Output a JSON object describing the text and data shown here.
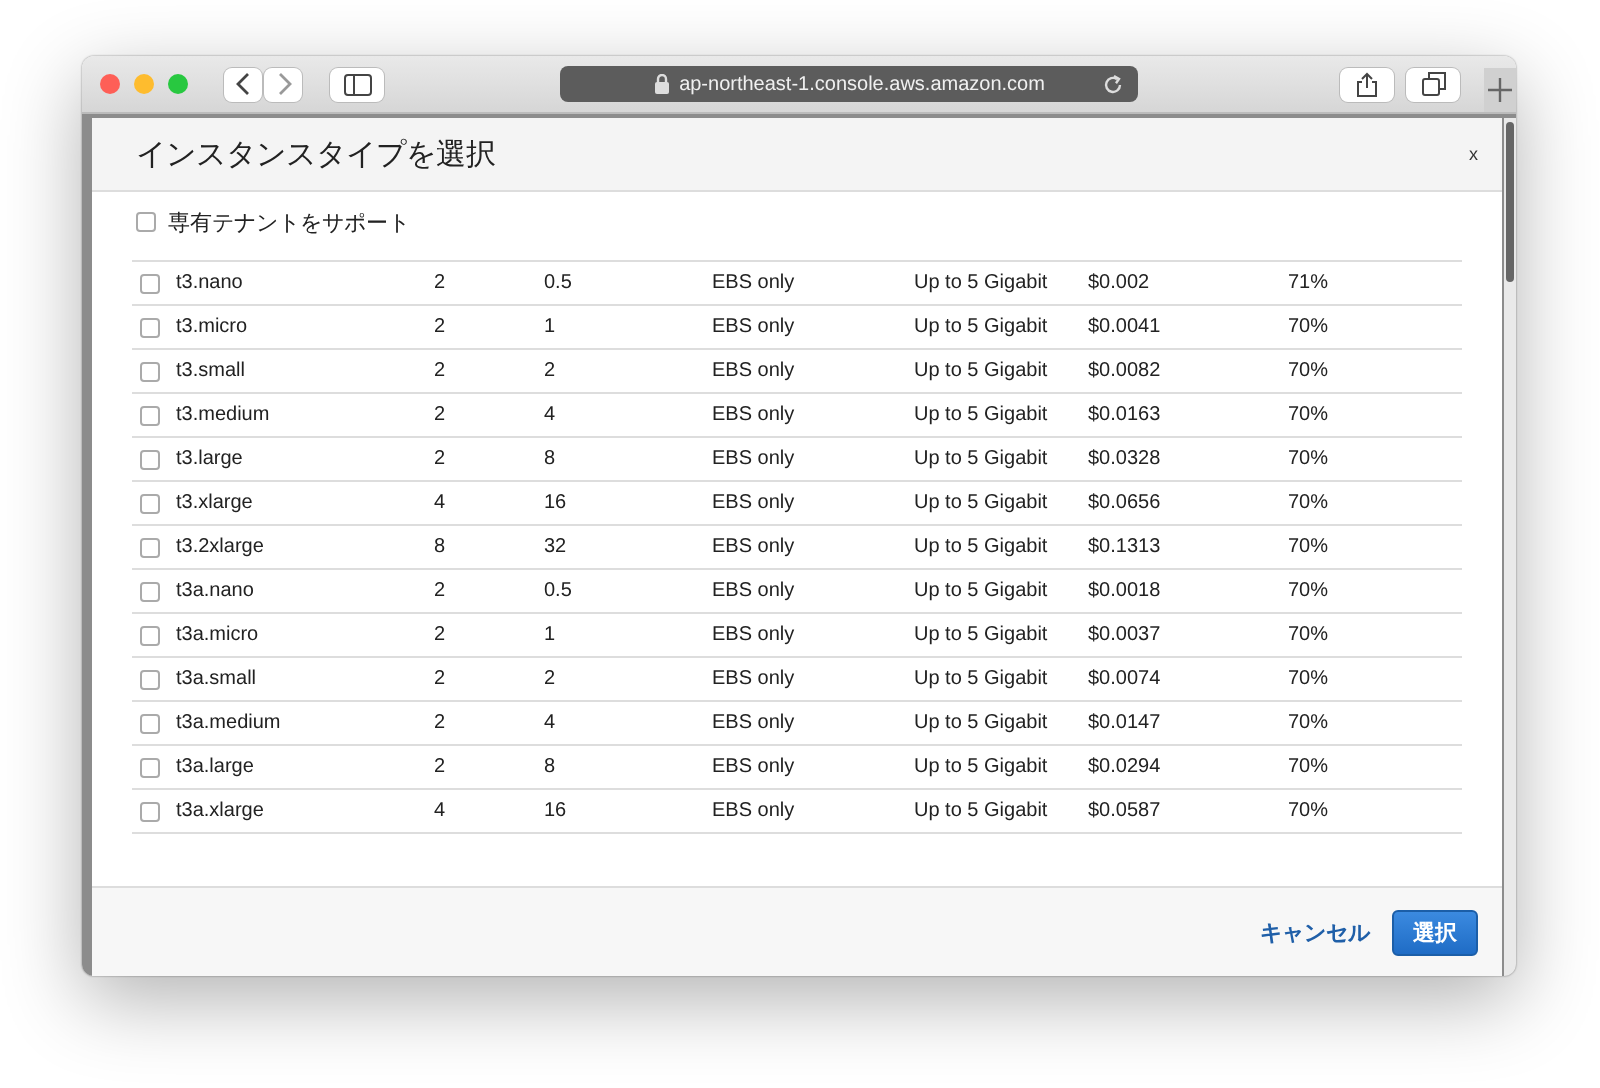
{
  "browser": {
    "url": "ap-northeast-1.console.aws.amazon.com"
  },
  "dialog": {
    "title": "インスタンスタイプを選択",
    "close": "x"
  },
  "filter": {
    "label": "専有テナントをサポート",
    "checked": false
  },
  "table": {
    "rows": [
      {
        "checked": false,
        "cells": [
          "t3.nano",
          "2",
          "0.5",
          "EBS only",
          "Up to 5 Gigabit",
          "$0.002",
          "71%"
        ]
      },
      {
        "checked": false,
        "cells": [
          "t3.micro",
          "2",
          "1",
          "EBS only",
          "Up to 5 Gigabit",
          "$0.0041",
          "70%"
        ]
      },
      {
        "checked": false,
        "cells": [
          "t3.small",
          "2",
          "2",
          "EBS only",
          "Up to 5 Gigabit",
          "$0.0082",
          "70%"
        ]
      },
      {
        "checked": false,
        "cells": [
          "t3.medium",
          "2",
          "4",
          "EBS only",
          "Up to 5 Gigabit",
          "$0.0163",
          "70%"
        ]
      },
      {
        "checked": false,
        "cells": [
          "t3.large",
          "2",
          "8",
          "EBS only",
          "Up to 5 Gigabit",
          "$0.0328",
          "70%"
        ]
      },
      {
        "checked": false,
        "cells": [
          "t3.xlarge",
          "4",
          "16",
          "EBS only",
          "Up to 5 Gigabit",
          "$0.0656",
          "70%"
        ]
      },
      {
        "checked": false,
        "cells": [
          "t3.2xlarge",
          "8",
          "32",
          "EBS only",
          "Up to 5 Gigabit",
          "$0.1313",
          "70%"
        ]
      },
      {
        "checked": false,
        "cells": [
          "t3a.nano",
          "2",
          "0.5",
          "EBS only",
          "Up to 5 Gigabit",
          "$0.0018",
          "70%"
        ]
      },
      {
        "checked": false,
        "cells": [
          "t3a.micro",
          "2",
          "1",
          "EBS only",
          "Up to 5 Gigabit",
          "$0.0037",
          "70%"
        ]
      },
      {
        "checked": false,
        "cells": [
          "t3a.small",
          "2",
          "2",
          "EBS only",
          "Up to 5 Gigabit",
          "$0.0074",
          "70%"
        ]
      },
      {
        "checked": false,
        "cells": [
          "t3a.medium",
          "2",
          "4",
          "EBS only",
          "Up to 5 Gigabit",
          "$0.0147",
          "70%"
        ]
      },
      {
        "checked": false,
        "cells": [
          "t3a.large",
          "2",
          "8",
          "EBS only",
          "Up to 5 Gigabit",
          "$0.0294",
          "70%"
        ]
      },
      {
        "checked": false,
        "cells": [
          "t3a.xlarge",
          "4",
          "16",
          "EBS only",
          "Up to 5 Gigabit",
          "$0.0587",
          "70%"
        ]
      }
    ]
  },
  "footer": {
    "cancel": "キャンセル",
    "confirm": "選択"
  }
}
